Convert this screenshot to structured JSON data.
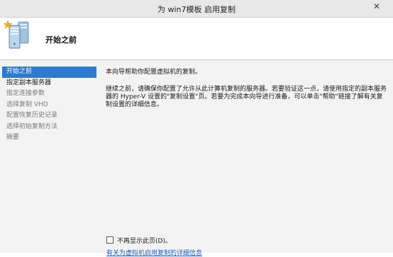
{
  "window": {
    "title": "为 win7模板 启用复制",
    "close_glyph": "✕"
  },
  "header": {
    "title": "开始之前",
    "icon": "server-replication-wizard-icon"
  },
  "nav": {
    "items": [
      {
        "label": "开始之前",
        "state": "active"
      },
      {
        "label": "指定副本服务器",
        "state": "enabled"
      },
      {
        "label": "指定连接参数",
        "state": "disabled"
      },
      {
        "label": "选择复制 VHD",
        "state": "disabled"
      },
      {
        "label": "配置恢复历史记录",
        "state": "disabled"
      },
      {
        "label": "选择初始复制方法",
        "state": "disabled"
      },
      {
        "label": "摘要",
        "state": "disabled"
      }
    ]
  },
  "content": {
    "para1": "本向导帮助你配置虚拟机的复制。",
    "para2": "继续之前，请确保你配置了允许从此计算机复制的服务器。若要验证这一点，请使用指定的副本服务器的 Hyper-V 设置的\"复制设置\"页。若要为完成本向导进行准备，可以单击\"帮助\"链接了解有关复制设置的详细信息。",
    "dont_show_label": "不再显示此页(D)。",
    "dont_show_checked": false,
    "more_link": "有关为虚拟机启用复制的详细信息"
  },
  "colors": {
    "accent": "#2b7bd2",
    "link": "#1c5fbf",
    "nav_bg": "#f3f3f3"
  }
}
